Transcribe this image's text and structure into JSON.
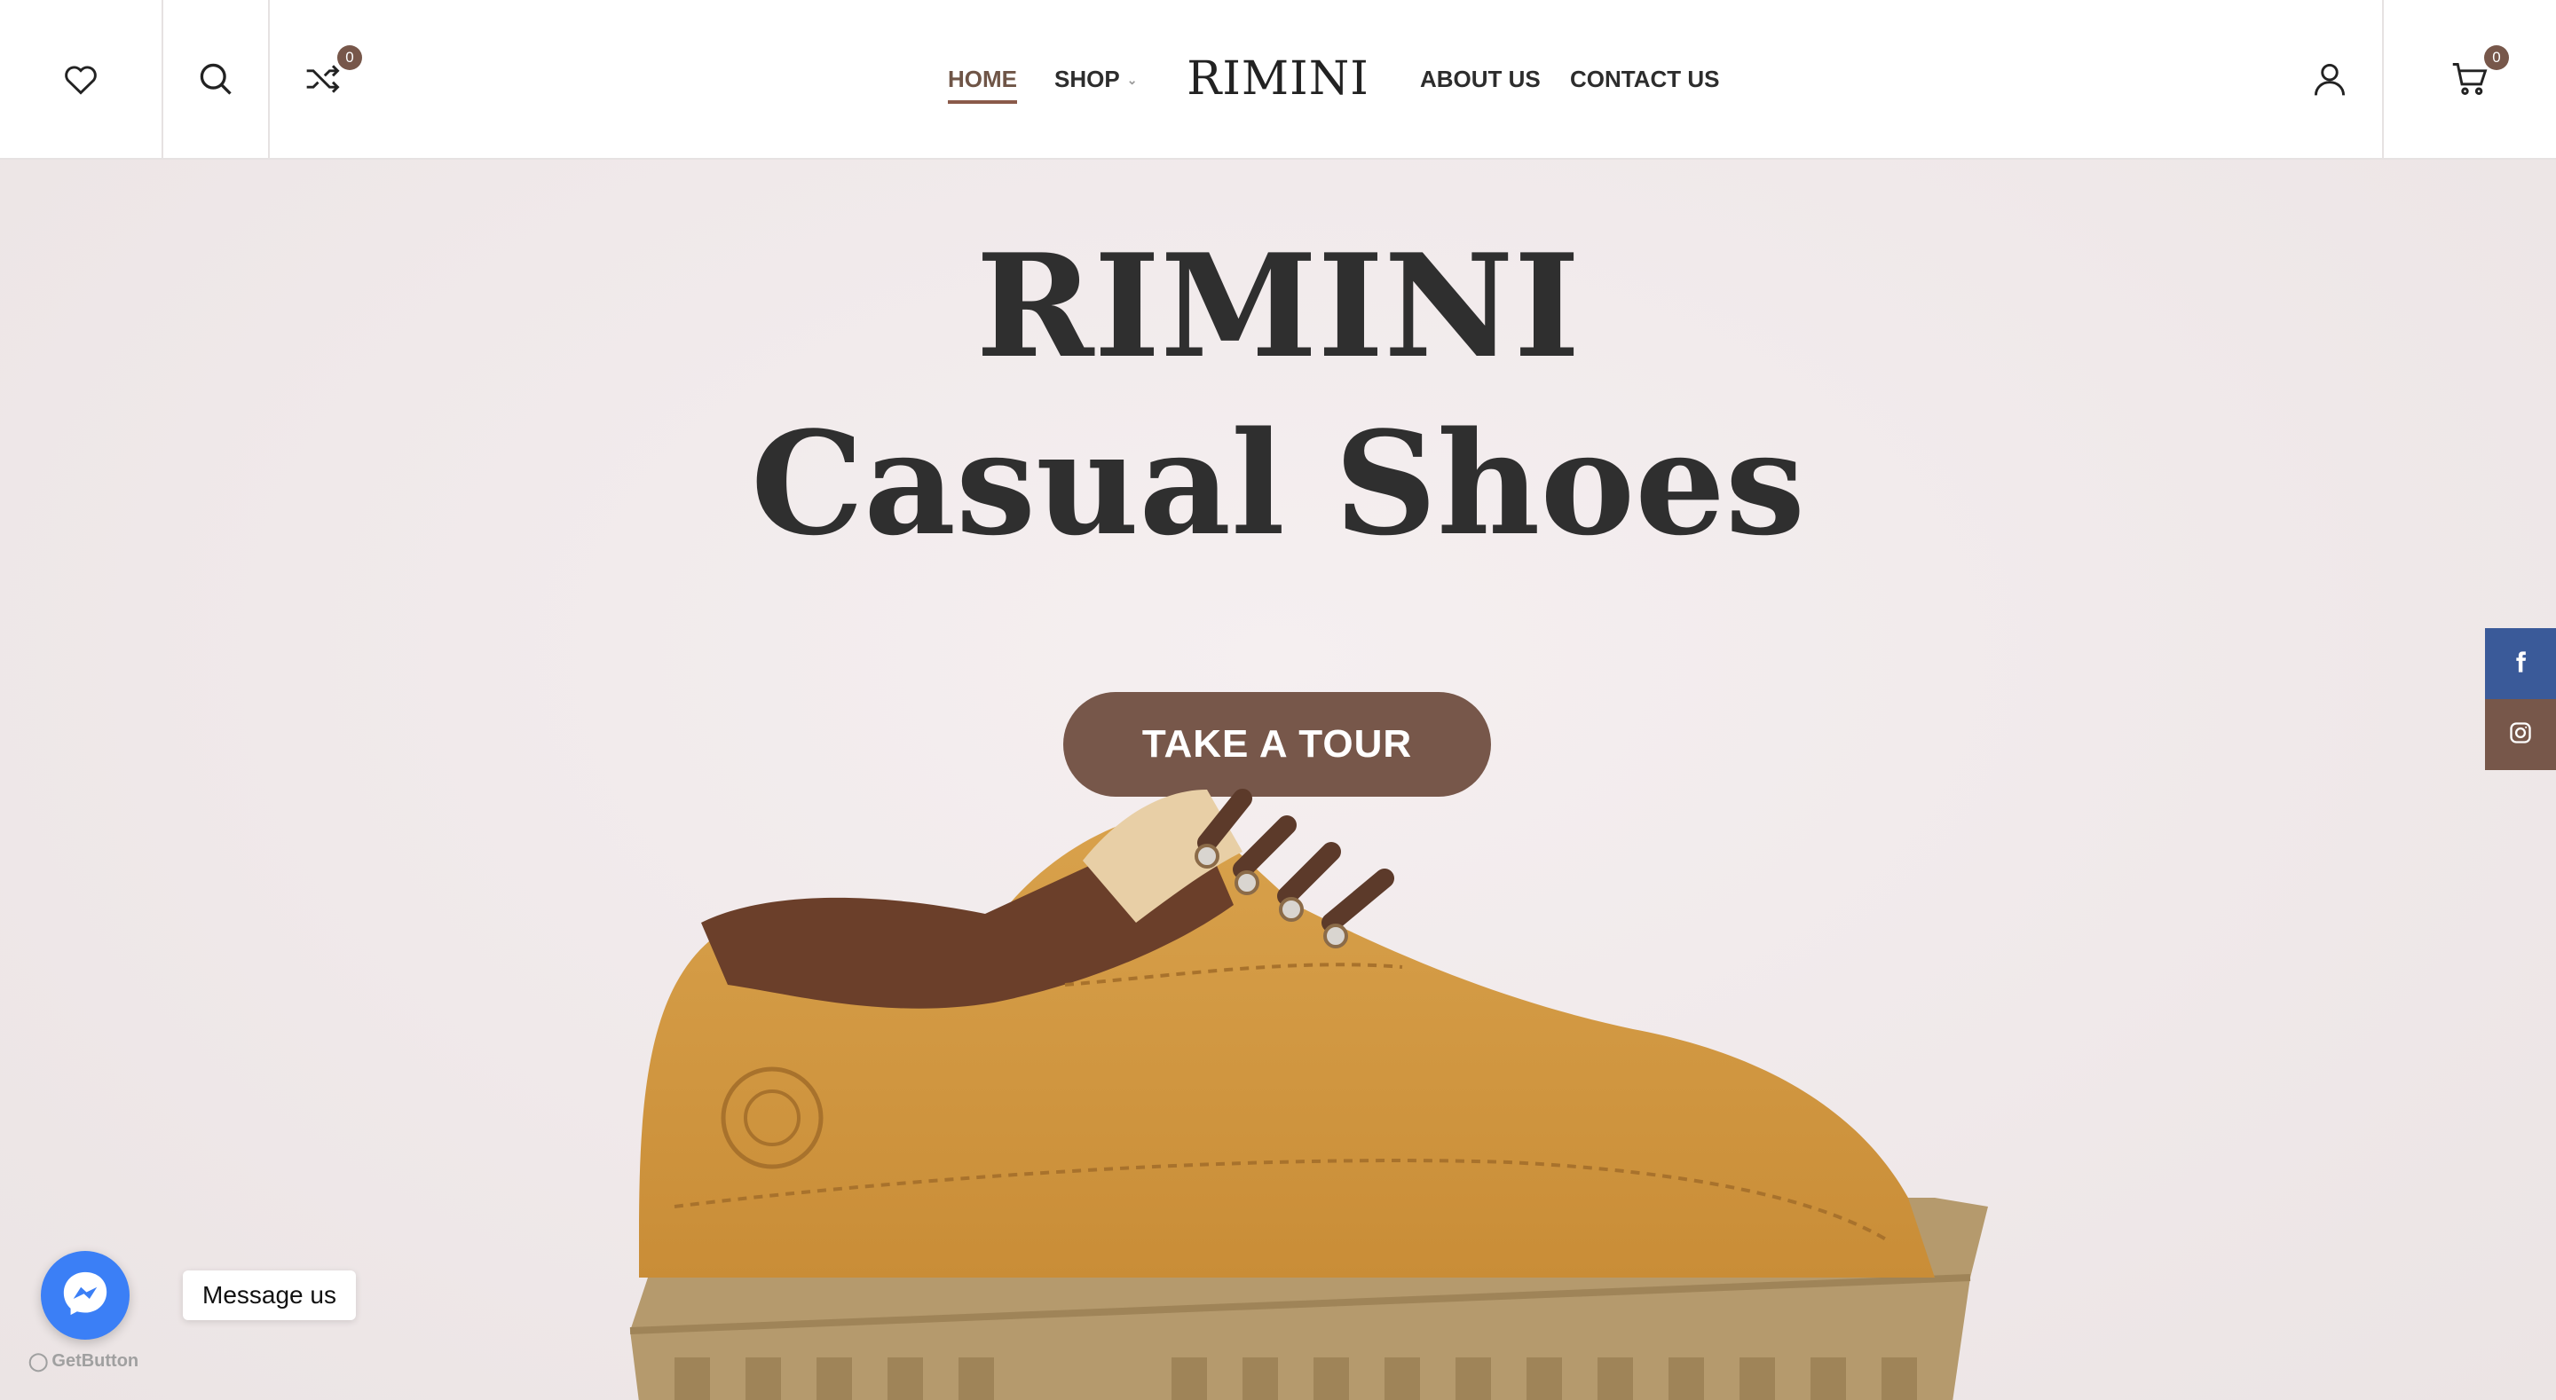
{
  "header": {
    "wishlist_icon": "heart-icon",
    "search_icon": "search-icon",
    "compare_icon": "shuffle-icon",
    "compare_count": "0",
    "nav_left": [
      "HOME",
      "SHOP"
    ],
    "logo": "RIMINI",
    "nav_right": [
      "ABOUT US",
      "CONTACT US"
    ],
    "account_icon": "user-icon",
    "cart_icon": "cart-icon",
    "cart_count": "0",
    "active_nav": "HOME"
  },
  "hero": {
    "title_line1": "RIMINI",
    "title_line2": "Casual Shoes",
    "button_label": "TAKE A TOUR"
  },
  "social": {
    "items": [
      {
        "icon": "facebook-icon",
        "color": "#3a5a99"
      },
      {
        "icon": "instagram-icon",
        "color": "#77574a"
      }
    ]
  },
  "chat": {
    "label": "Message us",
    "powered_by": "GetButton",
    "icon": "messenger-icon"
  },
  "colors": {
    "accent": "#77574a",
    "text": "#2f2f2f",
    "background": "#f1ebec"
  }
}
